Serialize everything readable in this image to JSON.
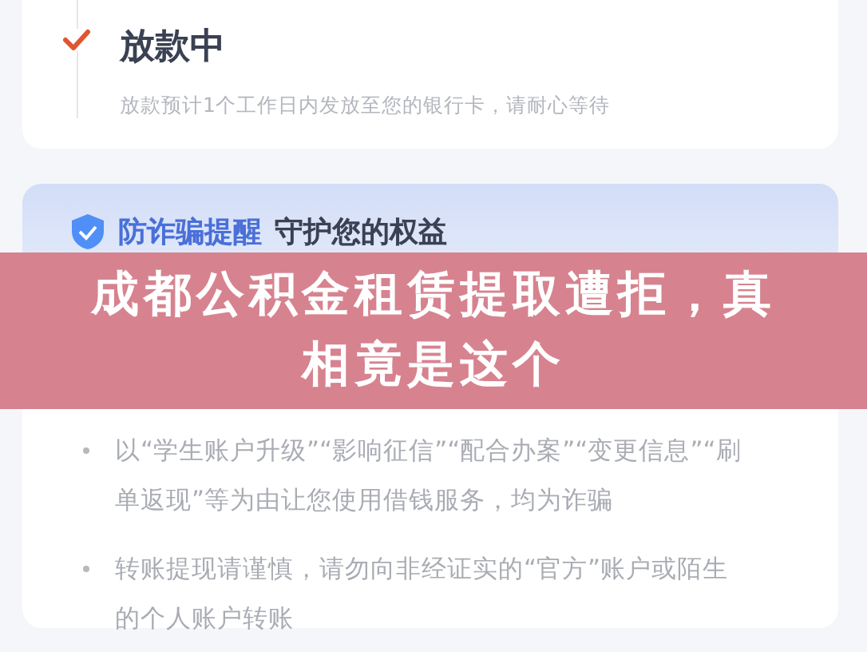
{
  "status_card": {
    "title": "放款中",
    "description": "放款预计1个工作日内发放至您的银行卡，请耐心等待",
    "checked": true
  },
  "notice_card": {
    "heading_highlight": "防诈骗提醒",
    "heading": "守护您的权益",
    "bullets": [
      "以“学生账户升级”“影响征信”“配合办案”“变更信息”“刷单返现”等为由让您使用借钱服务，均为诈骗",
      "转账提现请谨慎，请勿向非经证实的“官方”账户或陌生的个人账户转账"
    ]
  },
  "banner": {
    "title": "成都公积金租赁提取遭拒，真相竟是这个"
  }
}
